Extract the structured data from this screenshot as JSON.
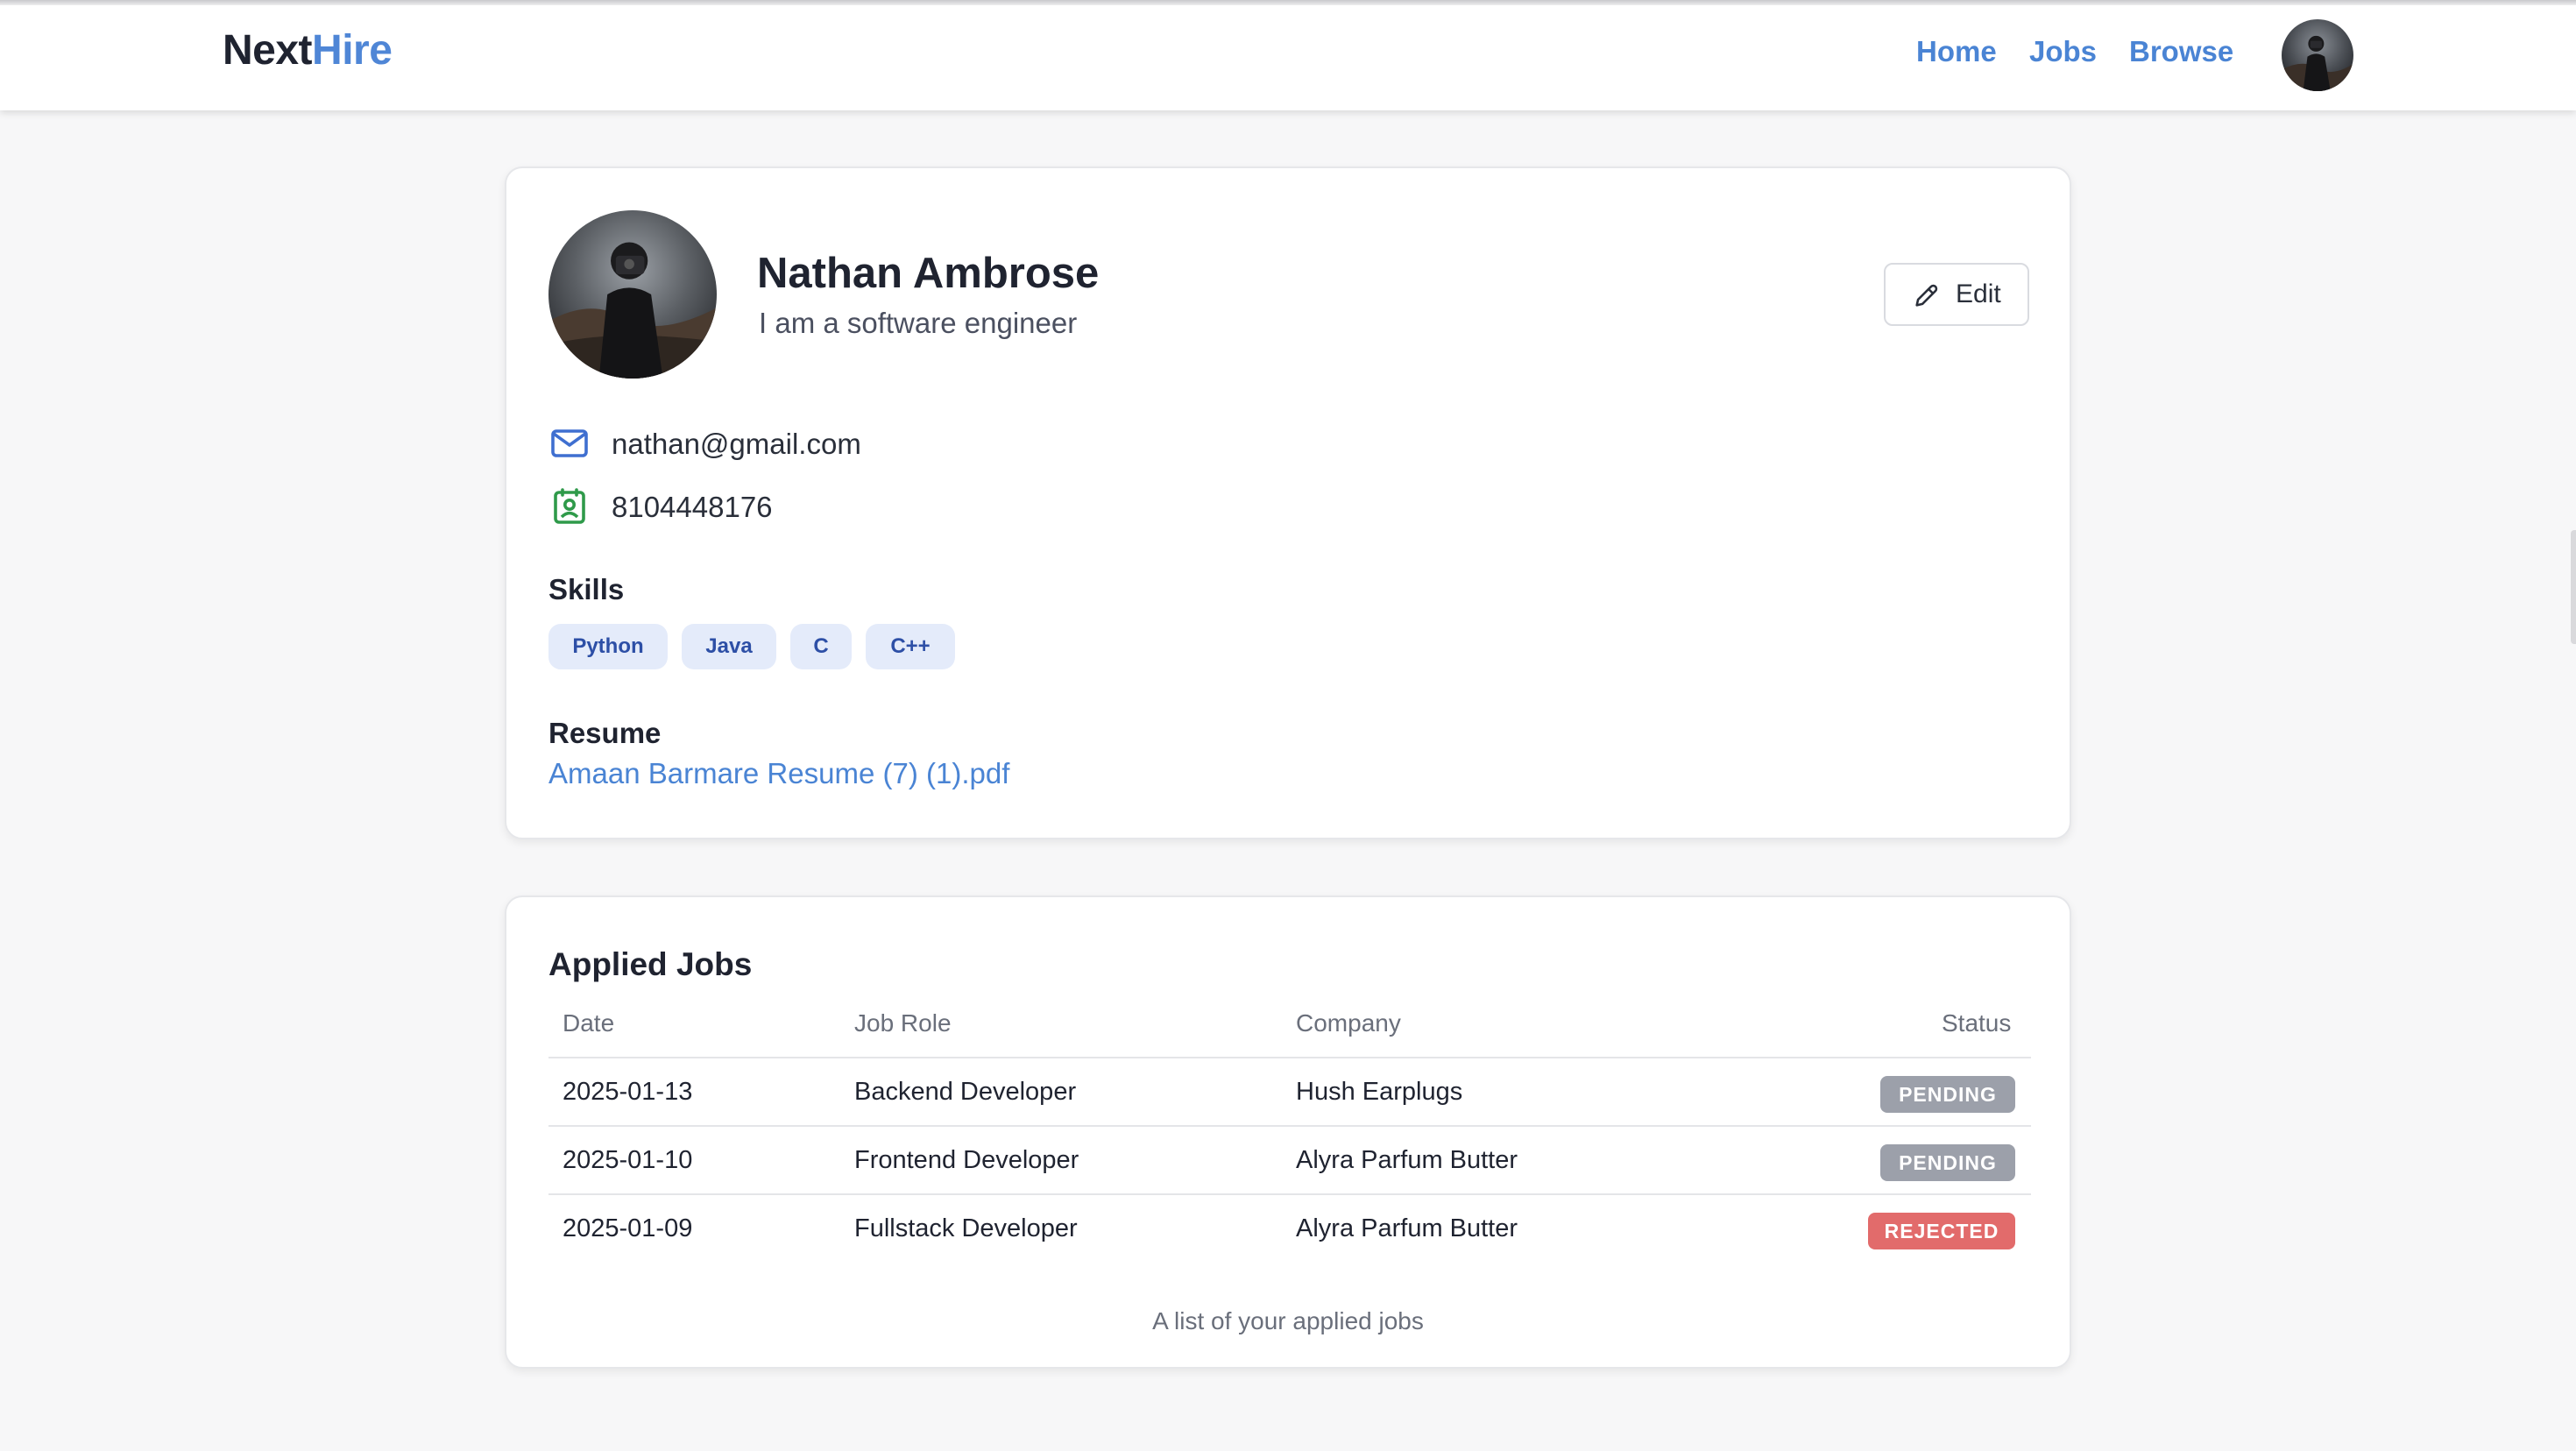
{
  "header": {
    "logo_part1": "Next",
    "logo_part2": "Hire",
    "nav": [
      "Home",
      "Jobs",
      "Browse"
    ]
  },
  "profile": {
    "name": "Nathan Ambrose",
    "bio": "I am a software engineer",
    "edit_label": "Edit",
    "email": "nathan@gmail.com",
    "phone": "8104448176",
    "skills_label": "Skills",
    "skills": [
      "Python",
      "Java",
      "C",
      "C++"
    ],
    "resume_label": "Resume",
    "resume_file": "Amaan Barmare Resume (7) (1).pdf"
  },
  "applied_jobs": {
    "title": "Applied Jobs",
    "columns": [
      "Date",
      "Job Role",
      "Company",
      "Status"
    ],
    "rows": [
      {
        "date": "2025-01-13",
        "role": "Backend Developer",
        "company": "Hush Earplugs",
        "status": "PENDING"
      },
      {
        "date": "2025-01-10",
        "role": "Frontend Developer",
        "company": "Alyra Parfum Butter",
        "status": "PENDING"
      },
      {
        "date": "2025-01-09",
        "role": "Fullstack Developer",
        "company": "Alyra Parfum Butter",
        "status": "REJECTED"
      }
    ],
    "caption": "A list of your applied jobs"
  },
  "colors": {
    "brand": "#4f86d6",
    "link": "#4a84d4",
    "pending": "#9ca0aa",
    "rejected": "#e26b6b",
    "skill_bg": "#e4ebfa"
  },
  "icons": {
    "email": "mail-icon",
    "phone": "contact-card-icon",
    "edit": "pencil-icon"
  }
}
